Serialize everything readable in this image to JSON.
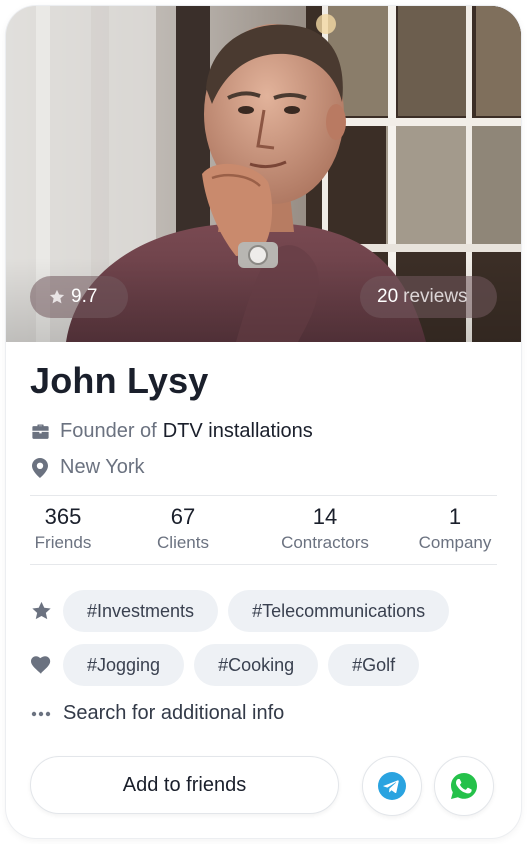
{
  "profile": {
    "rating": "9.7",
    "reviews_count": "20",
    "reviews_label": "reviews",
    "name": "John Lysy",
    "role_prefix": "Founder of",
    "company": "DTV installations",
    "location": "New York"
  },
  "stats": [
    {
      "value": "365",
      "label": "Friends"
    },
    {
      "value": "67",
      "label": "Clients"
    },
    {
      "value": "14",
      "label": "Contractors"
    },
    {
      "value": "1",
      "label": "Company"
    }
  ],
  "interests": [
    "#Investments",
    "#Telecommunications"
  ],
  "hobbies": [
    "#Jogging",
    "#Cooking",
    "#Golf"
  ],
  "more_info": "Search for additional info",
  "actions": {
    "add_friend": "Add to friends"
  },
  "icons": {
    "rating": "star-icon",
    "role": "briefcase-icon",
    "location": "location-pin-icon",
    "interests": "star-icon",
    "hobbies": "heart-icon",
    "more": "more-dots-icon",
    "telegram": "telegram-icon",
    "whatsapp": "whatsapp-icon"
  },
  "colors": {
    "telegram": "#2aa3e0",
    "whatsapp": "#25c14a",
    "tag_bg": "#eef1f5",
    "icon_gray": "#6b7280"
  }
}
